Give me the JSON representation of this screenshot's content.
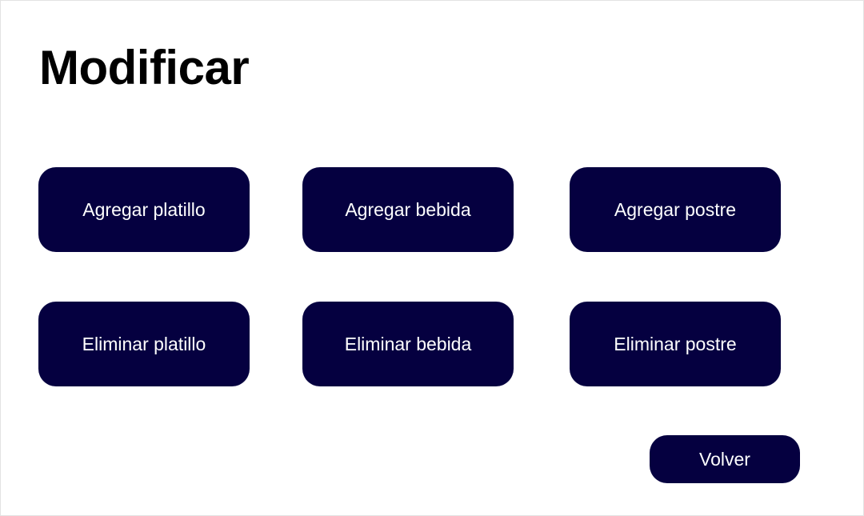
{
  "page": {
    "title": "Modificar"
  },
  "buttons": {
    "add_dish": "Agregar platillo",
    "add_drink": "Agregar bebida",
    "add_dessert": "Agregar postre",
    "delete_dish": "Eliminar platillo",
    "delete_drink": "Eliminar bebida",
    "delete_dessert": "Eliminar postre",
    "back": "Volver"
  },
  "colors": {
    "button_background": "#050040",
    "button_text": "#ffffff",
    "title_text": "#000000",
    "page_background": "#ffffff"
  }
}
